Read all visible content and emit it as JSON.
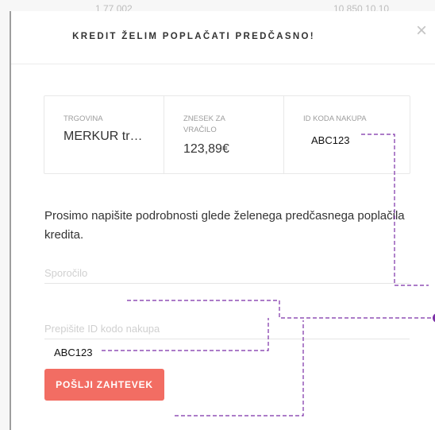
{
  "background": {
    "peek_left": "1 77 002",
    "peek_right": "10 850 10.10"
  },
  "modal": {
    "title": "KREDIT ŽELIM POPLAČATI PREDČASNO!",
    "close_icon": "close-icon"
  },
  "summary": {
    "store_label": "TRGOVINA",
    "store_value": "MERKUR tr…",
    "amount_label": "ZNESEK ZA VRAČILO",
    "amount_value": "123,89€",
    "id_label": "ID KODA NAKUPA",
    "id_value": "ABC123"
  },
  "form": {
    "description": "Prosimo napišite podrobnosti glede želenega predčasnega poplačila kredita.",
    "message_placeholder": "Sporočilo",
    "code_placeholder": "Prepišite ID kodo nakupa",
    "code_typed": "ABC123",
    "submit_label": "POŠLJI ZAHTEVEK"
  },
  "colors": {
    "accent": "#f26d63",
    "annotation": "#7b2fa6"
  }
}
